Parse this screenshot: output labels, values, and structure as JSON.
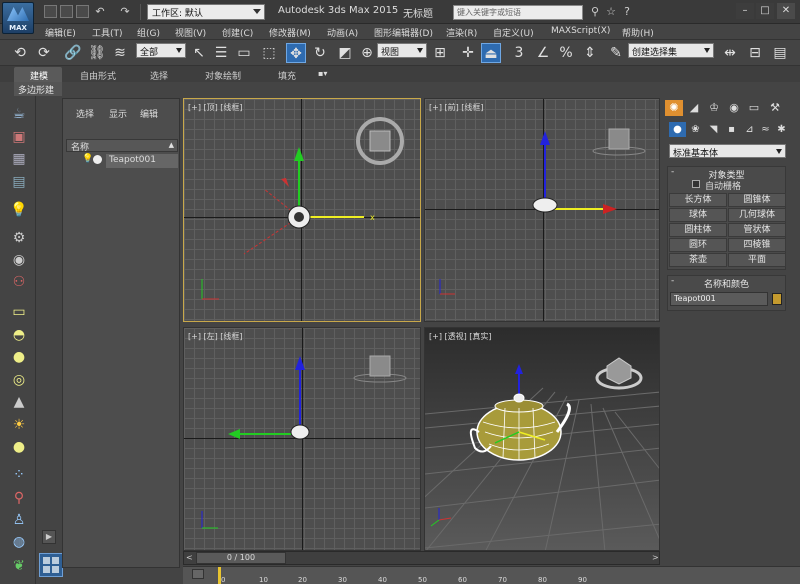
{
  "title_bar": {
    "logo_text": "MAX",
    "workspace_value": "工作区: 默认",
    "app_title": "Autodesk 3ds Max  2015",
    "doc_title": "无标题",
    "search_placeholder": "键入关键字或短语"
  },
  "menu": {
    "items": [
      "编辑(E)",
      "工具(T)",
      "组(G)",
      "视图(V)",
      "创建(C)",
      "修改器(M)",
      "动画(A)",
      "图形编辑器(D)",
      "渲染(R)",
      "自定义(U)",
      "MAXScript(X)",
      "帮助(H)"
    ]
  },
  "main_toolbar": {
    "selection_filter": "全部",
    "ref_coord": "视图",
    "selection_set": "创建选择集",
    "snap_label": "3",
    "angle_snap_label": "%"
  },
  "ribbon": {
    "tabs": [
      "建模",
      "自由形式",
      "选择",
      "对象绘制",
      "填充"
    ],
    "sub_label": "多边形建模"
  },
  "scene_explorer": {
    "menus": [
      "选择",
      "显示",
      "编辑"
    ],
    "column_header": "名称",
    "object": "Teapot001"
  },
  "viewports": {
    "top": "[+] [顶] [线框]",
    "front": "[+] [前] [线框]",
    "left": "[+] [左] [线框]",
    "perspective": "[+] [透视] [真实]"
  },
  "command_panel": {
    "category_dropdown": "标准基本体",
    "object_type_title": "对象类型",
    "autogrid_label": "自动栅格",
    "object_buttons": [
      "长方体",
      "圆锥体",
      "球体",
      "几何球体",
      "圆柱体",
      "管状体",
      "圆环",
      "四棱锥",
      "茶壶",
      "平面"
    ],
    "name_color_title": "名称和颜色",
    "object_name": "Teapot001",
    "object_color": "#c49a2e"
  },
  "timeline": {
    "frame_indicator": "0 / 100",
    "ticks": [
      "0",
      "10",
      "20",
      "30",
      "40",
      "50",
      "60",
      "70",
      "80",
      "90"
    ]
  },
  "colors": {
    "selected_viewport_border": "#c8a84a",
    "active_tool": "#2e6bb0"
  }
}
